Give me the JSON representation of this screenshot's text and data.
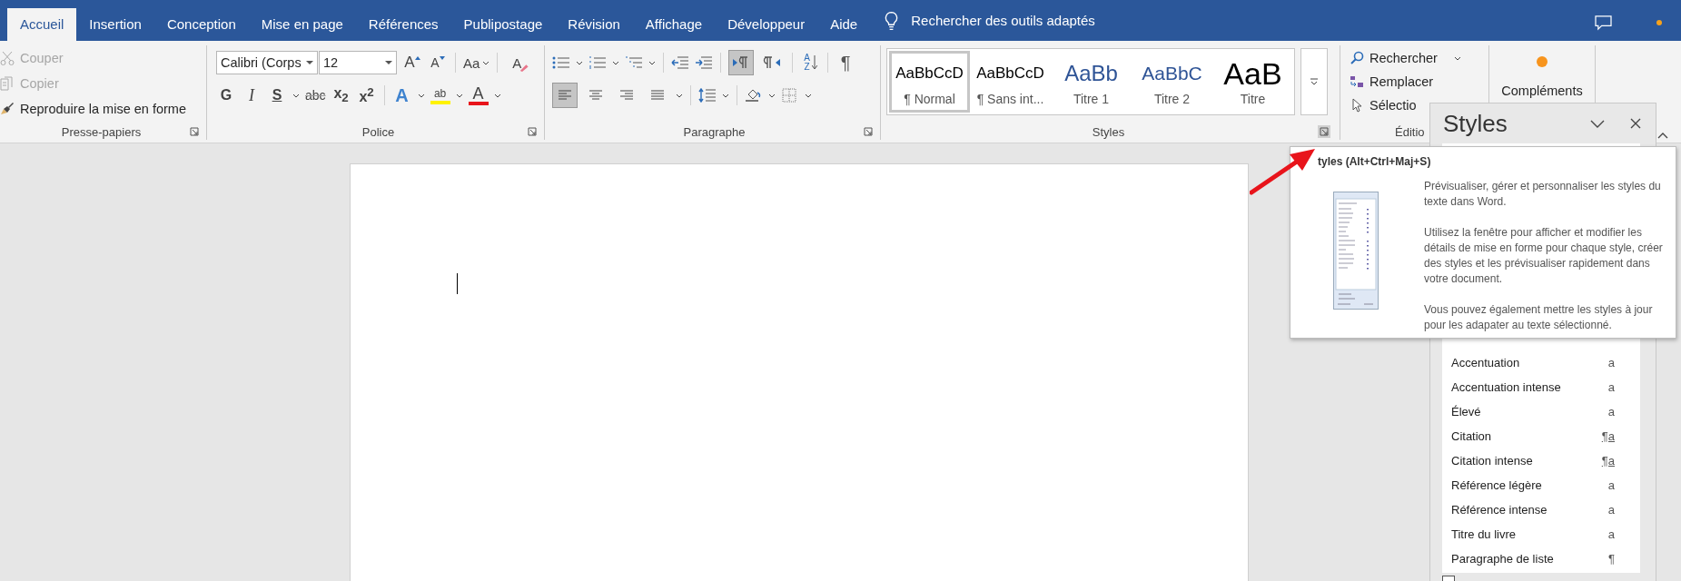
{
  "tabs": [
    {
      "label": "Accueil",
      "selected": true
    },
    {
      "label": "Insertion",
      "selected": false
    },
    {
      "label": "Conception",
      "selected": false
    },
    {
      "label": "Mise en page",
      "selected": false
    },
    {
      "label": "Références",
      "selected": false
    },
    {
      "label": "Publipostage",
      "selected": false
    },
    {
      "label": "Révision",
      "selected": false
    },
    {
      "label": "Affichage",
      "selected": false
    },
    {
      "label": "Développeur",
      "selected": false
    },
    {
      "label": "Aide",
      "selected": false
    }
  ],
  "search_text": "Rechercher des outils adaptés",
  "clipboard": {
    "label": "Presse-papiers",
    "buttons": [
      {
        "kind": "cut",
        "label": "Couper",
        "disabled": true
      },
      {
        "kind": "copy",
        "label": "Copier",
        "disabled": true
      },
      {
        "kind": "painter",
        "label": "Reproduire la mise en forme",
        "disabled": false
      }
    ]
  },
  "font": {
    "label": "Police",
    "font_name": "Calibri (Corps",
    "font_size": "12",
    "size_buttons": [
      {
        "kind": "grow",
        "glyph": "A"
      },
      {
        "kind": "shrink",
        "glyph": "A"
      },
      {
        "kind": "case",
        "glyph": "Aa"
      },
      {
        "kind": "clear",
        "glyph": "A"
      }
    ],
    "format_buttons": [
      {
        "kind": "bold",
        "glyph": "G"
      },
      {
        "kind": "italic",
        "glyph": "I"
      },
      {
        "kind": "underline",
        "glyph": "S"
      },
      {
        "kind": "strike",
        "glyph": "abc"
      },
      {
        "kind": "sub",
        "glyph": "x$_{2}$"
      },
      {
        "kind": "sup",
        "glyph": "x$^{2}$"
      }
    ],
    "effect_buttons": [
      {
        "kind": "effect",
        "glyph": "A"
      },
      {
        "kind": "highlight",
        "glyph": "ab"
      },
      {
        "kind": "color",
        "glyph": "A"
      }
    ]
  },
  "paragraph": {
    "label": "Paragraphe",
    "direction": [
      {
        "kind": "ltr",
        "selected": true
      },
      {
        "kind": "rtl",
        "selected": false
      }
    ],
    "sort_glyph": "AZ",
    "marks_glyph": "¶",
    "alignment": [
      {
        "kind": "left",
        "selected": true
      },
      {
        "kind": "center",
        "selected": false
      },
      {
        "kind": "right",
        "selected": false
      },
      {
        "kind": "justify",
        "selected": false
      }
    ]
  },
  "styles": {
    "label": "Styles",
    "gallery": [
      {
        "kind": "normal",
        "preview": "AaBbCcD",
        "name": "¶ Normal",
        "selected": true
      },
      {
        "kind": "normal",
        "preview": "AaBbCcD",
        "name": "¶ Sans int...",
        "selected": false
      },
      {
        "kind": "heading1",
        "preview": "AaBb",
        "name": "Titre 1",
        "selected": false
      },
      {
        "kind": "heading2",
        "preview": "AaBbC",
        "name": "Titre 2",
        "selected": false
      },
      {
        "kind": "title",
        "preview": "AaB",
        "name": "Titre",
        "selected": false
      }
    ]
  },
  "editing": {
    "label": "Éditio",
    "buttons": [
      {
        "kind": "find",
        "label": "Rechercher"
      },
      {
        "kind": "replace",
        "label": "Remplacer"
      },
      {
        "kind": "select",
        "label": "Sélectio"
      }
    ]
  },
  "addins": {
    "label": "Compléments"
  },
  "tooltip": {
    "title": "tyles (Alt+Ctrl+Maj+S)",
    "paragraphs": [
      "Prévisualiser, gérer et personnaliser les styles du texte dans Word.",
      "Utilisez la fenêtre pour afficher et modifier les détails de mise en forme pour chaque style, créer des styles et les prévisualiser rapidement dans votre document.",
      "Vous pouvez également mettre les styles à jour pour les adapater au texte sélectionné."
    ]
  },
  "styles_pane": {
    "title": "Styles",
    "items": [
      {
        "kind": "char",
        "name": "Accentuation",
        "marker": "a"
      },
      {
        "kind": "char",
        "name": "Accentuation intense",
        "marker": "a"
      },
      {
        "kind": "char",
        "name": "Élevé",
        "marker": "a"
      },
      {
        "kind": "linked",
        "name": "Citation",
        "marker": "¶a"
      },
      {
        "kind": "linked",
        "name": "Citation intense",
        "marker": "¶a"
      },
      {
        "kind": "char",
        "name": "Référence légère",
        "marker": "a"
      },
      {
        "kind": "char",
        "name": "Référence intense",
        "marker": "a"
      },
      {
        "kind": "char",
        "name": "Titre du livre",
        "marker": "a"
      },
      {
        "kind": "para",
        "name": "Paragraphe de liste",
        "marker": "¶"
      }
    ],
    "preview_checkbox": {
      "checked": false
    }
  }
}
